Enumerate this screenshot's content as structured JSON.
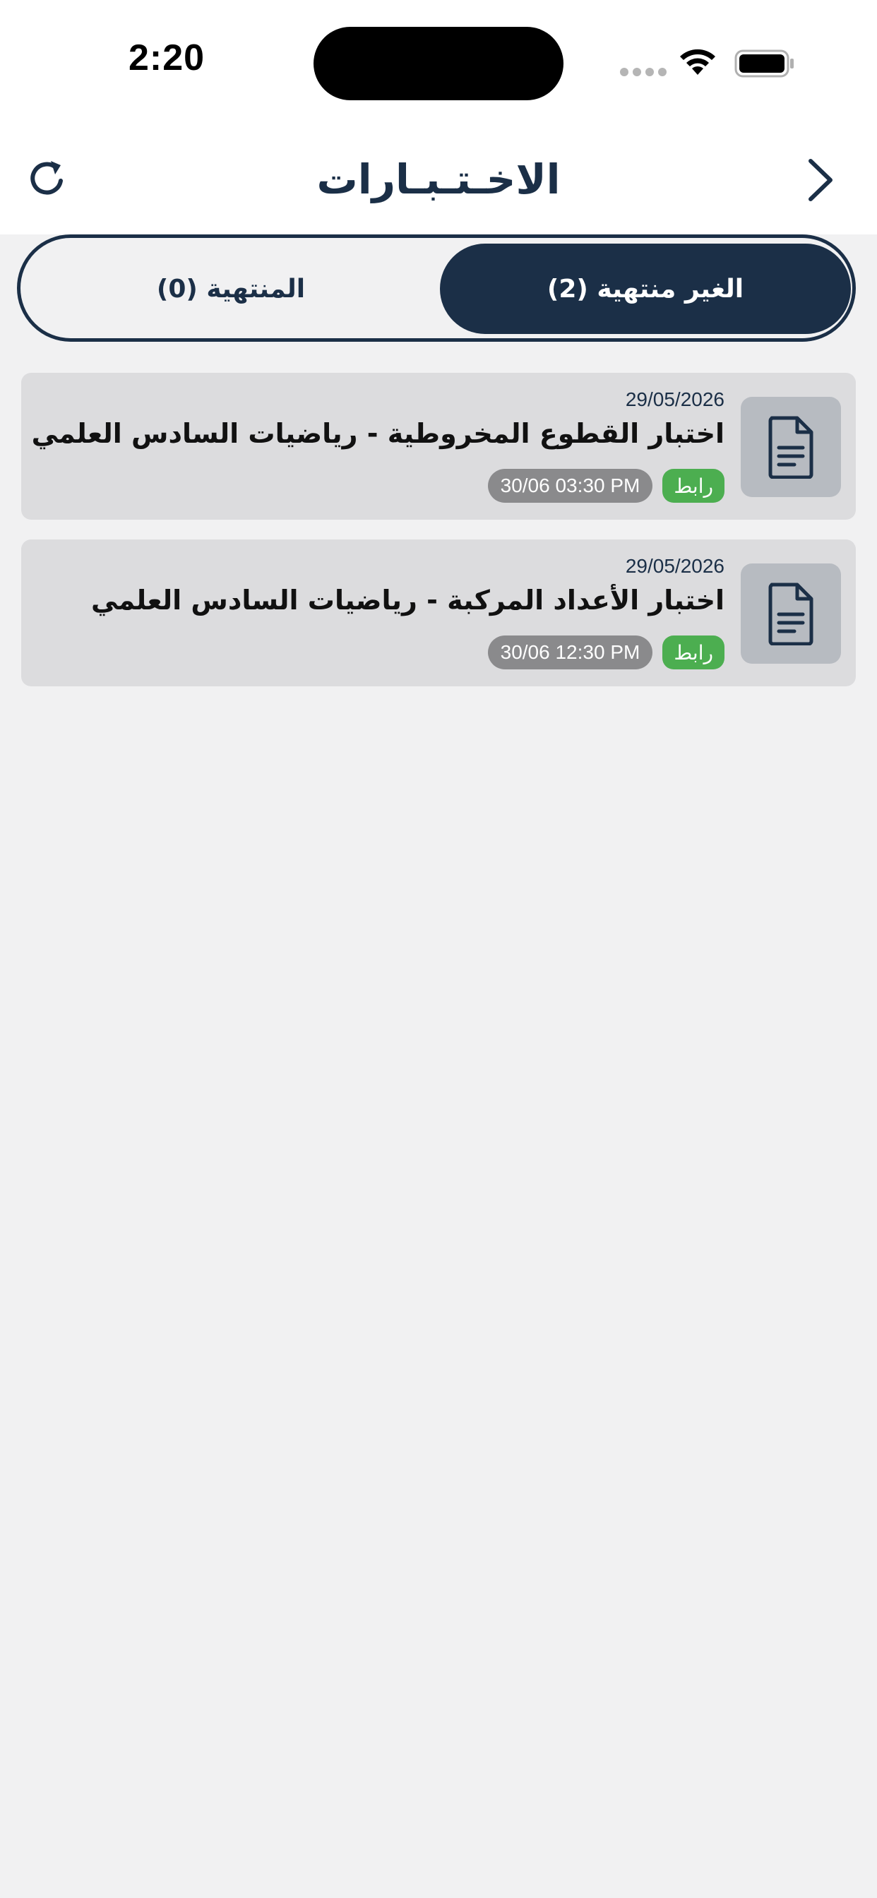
{
  "status_bar": {
    "time": "2:20"
  },
  "header": {
    "title": "الاخـتـبـارات",
    "refresh_icon": "refresh-icon",
    "back_icon": "chevron-right-icon"
  },
  "tabs": [
    {
      "label": "الغير منتهية (2)",
      "active": true
    },
    {
      "label": "المنتهية (0)",
      "active": false
    }
  ],
  "exams": [
    {
      "date": "29/05/2026",
      "title": "اختبار القطوع المخروطية - رياضيات السادس العلمي",
      "link_label": "رابط",
      "time": "30/06 03:30 PM",
      "icon": "document-icon"
    },
    {
      "date": "29/05/2026",
      "title": "اختبار الأعداد المركبة - رياضيات السادس العلمي",
      "link_label": "رابط",
      "time": "30/06 12:30 PM",
      "icon": "document-icon"
    }
  ],
  "colors": {
    "primary": "#1b2f47",
    "link_badge": "#4cae50",
    "time_badge": "#8a8a8c",
    "card_background": "#dcdcde",
    "page_background": "#f1f1f2"
  }
}
